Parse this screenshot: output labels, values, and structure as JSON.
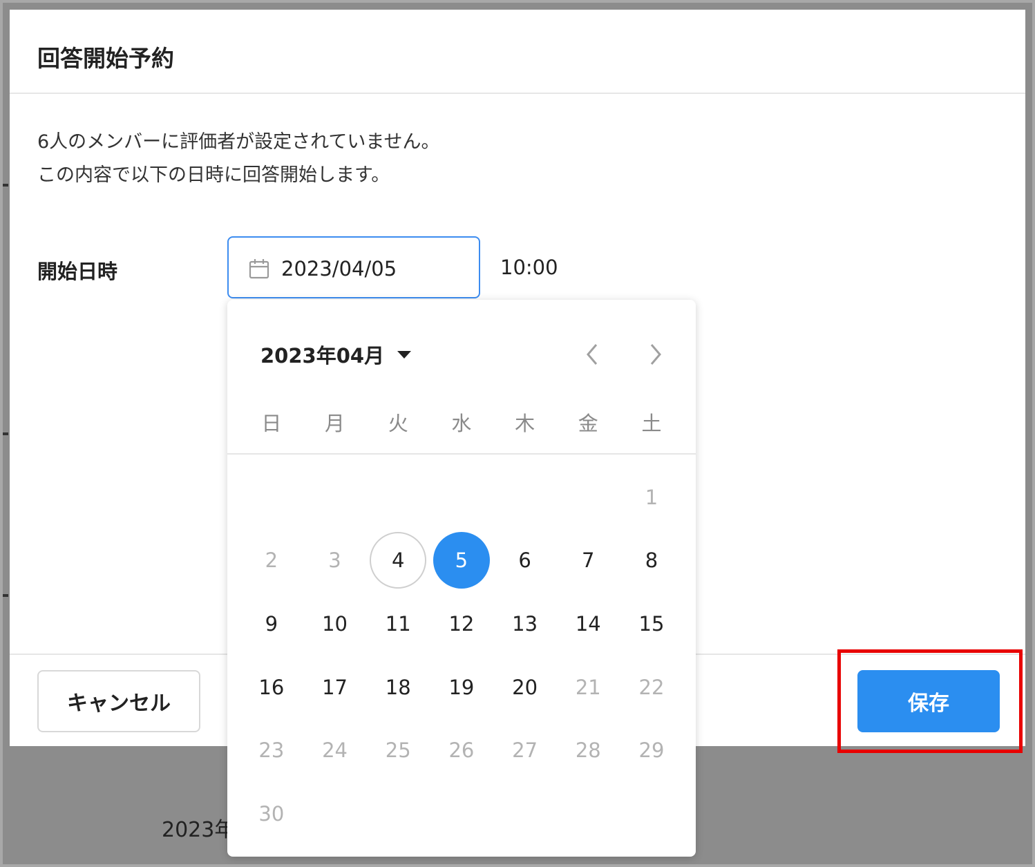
{
  "dialog": {
    "title": "回答開始予約",
    "message_line1": "6人のメンバーに評価者が設定されていません。",
    "message_line2": "この内容で以下の日時に回答開始します。",
    "field_label": "開始日時",
    "date_value": "2023/04/05",
    "time_value": "10:00",
    "cancel_label": "キャンセル",
    "save_label": "保存"
  },
  "background": {
    "partial_text": "2023年"
  },
  "picker": {
    "month_label": "2023年04月",
    "weekdays": [
      "日",
      "月",
      "火",
      "水",
      "木",
      "金",
      "土"
    ],
    "leading_blanks": 6,
    "days": [
      {
        "d": "1",
        "state": "disabled"
      },
      {
        "d": "2",
        "state": "disabled"
      },
      {
        "d": "3",
        "state": "disabled"
      },
      {
        "d": "4",
        "state": "today"
      },
      {
        "d": "5",
        "state": "selected"
      },
      {
        "d": "6",
        "state": "enabled"
      },
      {
        "d": "7",
        "state": "enabled"
      },
      {
        "d": "8",
        "state": "enabled"
      },
      {
        "d": "9",
        "state": "enabled"
      },
      {
        "d": "10",
        "state": "enabled"
      },
      {
        "d": "11",
        "state": "enabled"
      },
      {
        "d": "12",
        "state": "enabled"
      },
      {
        "d": "13",
        "state": "enabled"
      },
      {
        "d": "14",
        "state": "enabled"
      },
      {
        "d": "15",
        "state": "enabled"
      },
      {
        "d": "16",
        "state": "enabled"
      },
      {
        "d": "17",
        "state": "enabled"
      },
      {
        "d": "18",
        "state": "enabled"
      },
      {
        "d": "19",
        "state": "enabled"
      },
      {
        "d": "20",
        "state": "enabled"
      },
      {
        "d": "21",
        "state": "disabled"
      },
      {
        "d": "22",
        "state": "disabled"
      },
      {
        "d": "23",
        "state": "disabled"
      },
      {
        "d": "24",
        "state": "disabled"
      },
      {
        "d": "25",
        "state": "disabled"
      },
      {
        "d": "26",
        "state": "disabled"
      },
      {
        "d": "27",
        "state": "disabled"
      },
      {
        "d": "28",
        "state": "disabled"
      },
      {
        "d": "29",
        "state": "disabled"
      },
      {
        "d": "30",
        "state": "disabled"
      }
    ]
  },
  "colors": {
    "accent": "#2b8ef0",
    "highlight": "#e80000",
    "overlay": "#8c8c8c"
  },
  "icons": {
    "date_input": "calendar-icon",
    "month_dropdown": "caret-down-icon",
    "prev": "chevron-left-icon",
    "next": "chevron-right-icon"
  }
}
